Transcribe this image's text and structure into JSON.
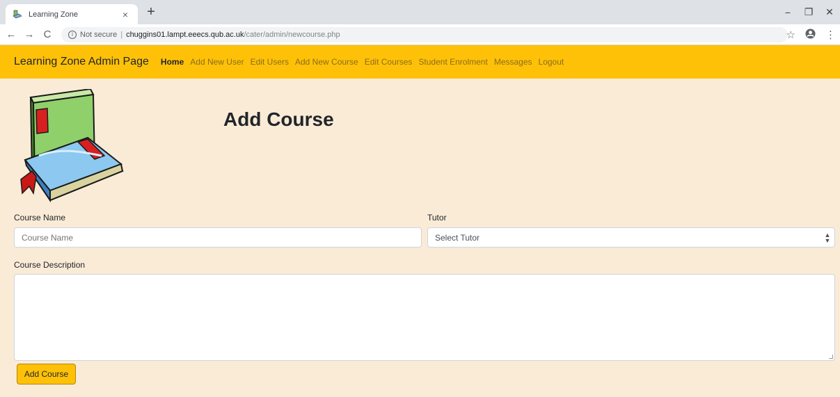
{
  "browser": {
    "tab_title": "Learning Zone",
    "tab_close": "×",
    "new_tab": "+",
    "window_controls": {
      "minimize": "−",
      "restore": "❐",
      "close": "✕"
    },
    "nav": {
      "back": "←",
      "forward": "→",
      "reload": "C"
    },
    "address": {
      "security_label": "Not secure",
      "separator": "|",
      "host": "chuggins01.lampt.eeecs.qub.ac.uk",
      "path": "/cater/admin/newcourse.php"
    },
    "toolbar_icons": {
      "bookmark": "☆",
      "profile": "●",
      "menu": "⋮"
    }
  },
  "navbar": {
    "brand": "Learning Zone Admin Page",
    "color": "#ffc107",
    "links": [
      {
        "label": "Home",
        "active": true
      },
      {
        "label": "Add New User",
        "active": false
      },
      {
        "label": "Edit Users",
        "active": false
      },
      {
        "label": "Add New Course",
        "active": false
      },
      {
        "label": "Edit Courses",
        "active": false
      },
      {
        "label": "Student Enrolment",
        "active": false
      },
      {
        "label": "Messages",
        "active": false
      },
      {
        "label": "Logout",
        "active": false
      }
    ]
  },
  "page": {
    "background": "#faebd7",
    "logo_icon": "books-icon",
    "title": "Add Course"
  },
  "form": {
    "course_name": {
      "label": "Course Name",
      "placeholder": "Course Name",
      "value": ""
    },
    "tutor": {
      "label": "Tutor",
      "selected": "Select Tutor"
    },
    "description": {
      "label": "Course Description",
      "value": ""
    },
    "submit_label": "Add Course"
  }
}
